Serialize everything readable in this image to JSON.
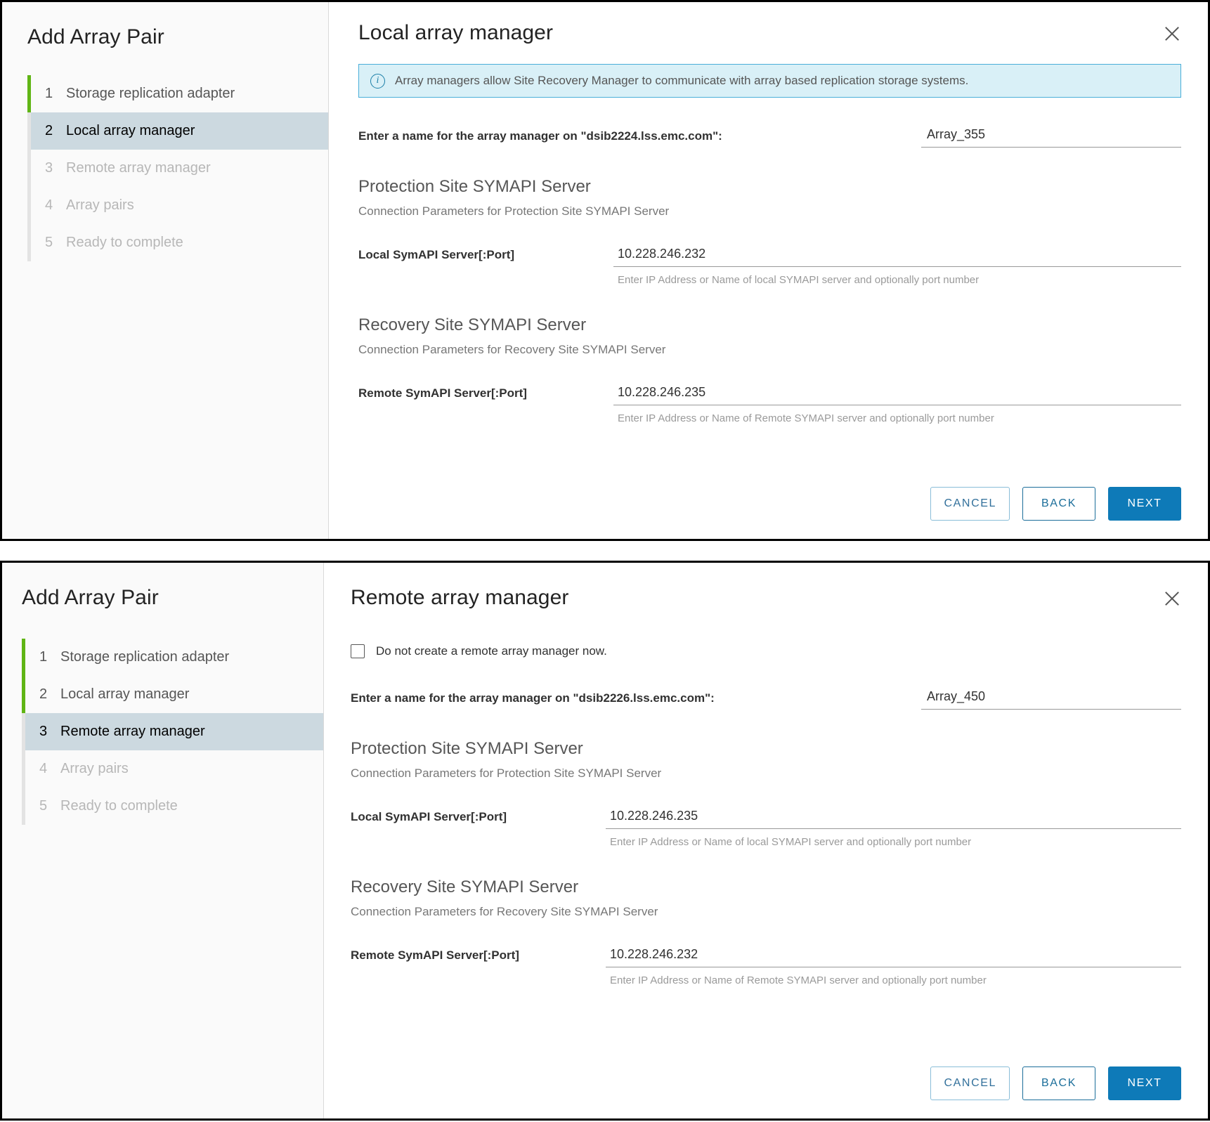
{
  "wizard_title": "Add Array Pair",
  "panel_local": {
    "pane_title": "Local array manager",
    "alert": {
      "icon": "info-icon",
      "text": "Array managers allow Site Recovery Manager to communicate with array based replication storage systems."
    },
    "steps": [
      {
        "num": "1",
        "label": "Storage replication adapter",
        "state": "done"
      },
      {
        "num": "2",
        "label": "Local array manager",
        "state": "active"
      },
      {
        "num": "3",
        "label": "Remote array manager",
        "state": "pending"
      },
      {
        "num": "4",
        "label": "Array pairs",
        "state": "pending"
      },
      {
        "num": "5",
        "label": "Ready to complete",
        "state": "pending"
      }
    ],
    "name_label": "Enter a name for the array manager on \"dsib2224.lss.emc.com\":",
    "name_value": "Array_355",
    "name_placeholder": "",
    "protection": {
      "title": "Protection Site SYMAPI Server",
      "subtitle": "Connection Parameters for Protection Site SYMAPI Server",
      "field_label": "Local SymAPI Server[:Port]",
      "field_value": "10.228.246.232",
      "field_hint": "Enter IP Address or Name of local SYMAPI server and optionally port number"
    },
    "recovery": {
      "title": "Recovery Site SYMAPI Server",
      "subtitle": "Connection Parameters for Recovery Site SYMAPI Server",
      "field_label": "Remote SymAPI Server[:Port]",
      "field_value": "10.228.246.235",
      "field_hint": "Enter IP Address or Name of Remote SYMAPI server and optionally port number"
    },
    "buttons": {
      "cancel": "CANCEL",
      "back": "BACK",
      "next": "NEXT"
    }
  },
  "panel_remote": {
    "pane_title": "Remote array manager",
    "checkbox_label": "Do not create a remote array manager now.",
    "checkbox_checked": false,
    "steps": [
      {
        "num": "1",
        "label": "Storage replication adapter",
        "state": "done"
      },
      {
        "num": "2",
        "label": "Local array manager",
        "state": "done"
      },
      {
        "num": "3",
        "label": "Remote array manager",
        "state": "active"
      },
      {
        "num": "4",
        "label": "Array pairs",
        "state": "pending"
      },
      {
        "num": "5",
        "label": "Ready to complete",
        "state": "pending"
      }
    ],
    "name_label": "Enter a name for the array manager on \"dsib2226.lss.emc.com\":",
    "name_value": "Array_450",
    "name_placeholder": "",
    "protection": {
      "title": "Protection Site SYMAPI Server",
      "subtitle": "Connection Parameters for Protection Site SYMAPI Server",
      "field_label": "Local SymAPI Server[:Port]",
      "field_value": "10.228.246.235",
      "field_hint": "Enter IP Address or Name of local SYMAPI server and optionally port number"
    },
    "recovery": {
      "title": "Recovery Site SYMAPI Server",
      "subtitle": "Connection Parameters for Recovery Site SYMAPI Server",
      "field_label": "Remote SymAPI Server[:Port]",
      "field_value": "10.228.246.232",
      "field_hint": "Enter IP Address or Name of Remote SYMAPI server and optionally port number"
    },
    "buttons": {
      "cancel": "CANCEL",
      "back": "BACK",
      "next": "NEXT"
    }
  },
  "colors": {
    "progress_green": "#60b515",
    "active_step_bg": "#ccd9e0",
    "primary_blue": "#0e7ab8",
    "alert_bg": "#d9f0f7",
    "alert_border": "#4aaed9"
  }
}
